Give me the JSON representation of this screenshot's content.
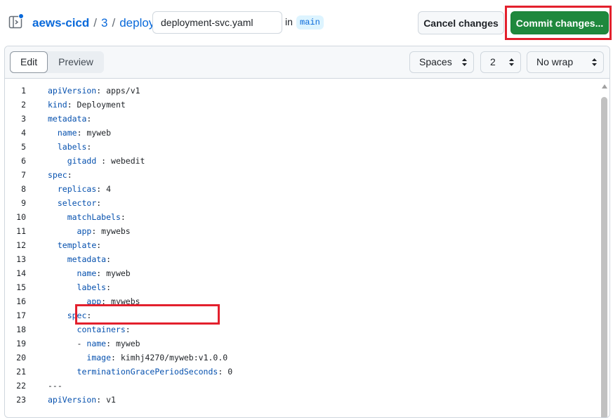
{
  "header": {
    "repo": "aews-cicd",
    "path": [
      "3",
      "deploy"
    ],
    "separator": "/",
    "filename": "deployment-svc.yaml",
    "in_label": "in",
    "branch": "main",
    "cancel_label": "Cancel changes",
    "commit_label": "Commit changes..."
  },
  "toolbar": {
    "tabs": [
      "Edit",
      "Preview"
    ],
    "active_tab": "Edit",
    "indent_mode": "Spaces",
    "indent_size": "2",
    "wrap_mode": "No wrap"
  },
  "editor": {
    "lines": [
      {
        "n": "1",
        "indent": "",
        "key": "apiVersion",
        "rest": ": apps/v1"
      },
      {
        "n": "2",
        "indent": "",
        "key": "kind",
        "rest": ": Deployment"
      },
      {
        "n": "3",
        "indent": "",
        "key": "metadata",
        "rest": ":"
      },
      {
        "n": "4",
        "indent": "  ",
        "key": "name",
        "rest": ": myweb"
      },
      {
        "n": "5",
        "indent": "  ",
        "key": "labels",
        "rest": ":"
      },
      {
        "n": "6",
        "indent": "    ",
        "key": "gitadd",
        "rest": " : webedit"
      },
      {
        "n": "7",
        "indent": "",
        "key": "spec",
        "rest": ":"
      },
      {
        "n": "8",
        "indent": "  ",
        "key": "replicas",
        "rest": ": 4"
      },
      {
        "n": "9",
        "indent": "  ",
        "key": "selector",
        "rest": ":"
      },
      {
        "n": "10",
        "indent": "    ",
        "key": "matchLabels",
        "rest": ":"
      },
      {
        "n": "11",
        "indent": "      ",
        "key": "app",
        "rest": ": mywebs"
      },
      {
        "n": "12",
        "indent": "  ",
        "key": "template",
        "rest": ":"
      },
      {
        "n": "13",
        "indent": "    ",
        "key": "metadata",
        "rest": ":"
      },
      {
        "n": "14",
        "indent": "      ",
        "key": "name",
        "rest": ": myweb"
      },
      {
        "n": "15",
        "indent": "      ",
        "key": "labels",
        "rest": ":"
      },
      {
        "n": "16",
        "indent": "        ",
        "key": "app",
        "rest": ": mywebs"
      },
      {
        "n": "17",
        "indent": "    ",
        "key": "spec",
        "rest": ":"
      },
      {
        "n": "18",
        "indent": "      ",
        "key": "containers",
        "rest": ":"
      },
      {
        "n": "19",
        "indent": "      - ",
        "key": "name",
        "rest": ": myweb"
      },
      {
        "n": "20",
        "indent": "        ",
        "key": "image",
        "rest": ": kimhj4270/myweb:v1.0.0"
      },
      {
        "n": "21",
        "indent": "      ",
        "key": "terminationGracePeriodSeconds",
        "rest": ": 0"
      },
      {
        "n": "22",
        "indent": "",
        "key": "",
        "rest": "---"
      },
      {
        "n": "23",
        "indent": "",
        "key": "apiVersion",
        "rest": ": v1"
      }
    ]
  },
  "colors": {
    "link": "#0969da",
    "commit_button": "#1f883d",
    "highlight_box": "#e3202d",
    "yaml_key": "#0550ae"
  }
}
